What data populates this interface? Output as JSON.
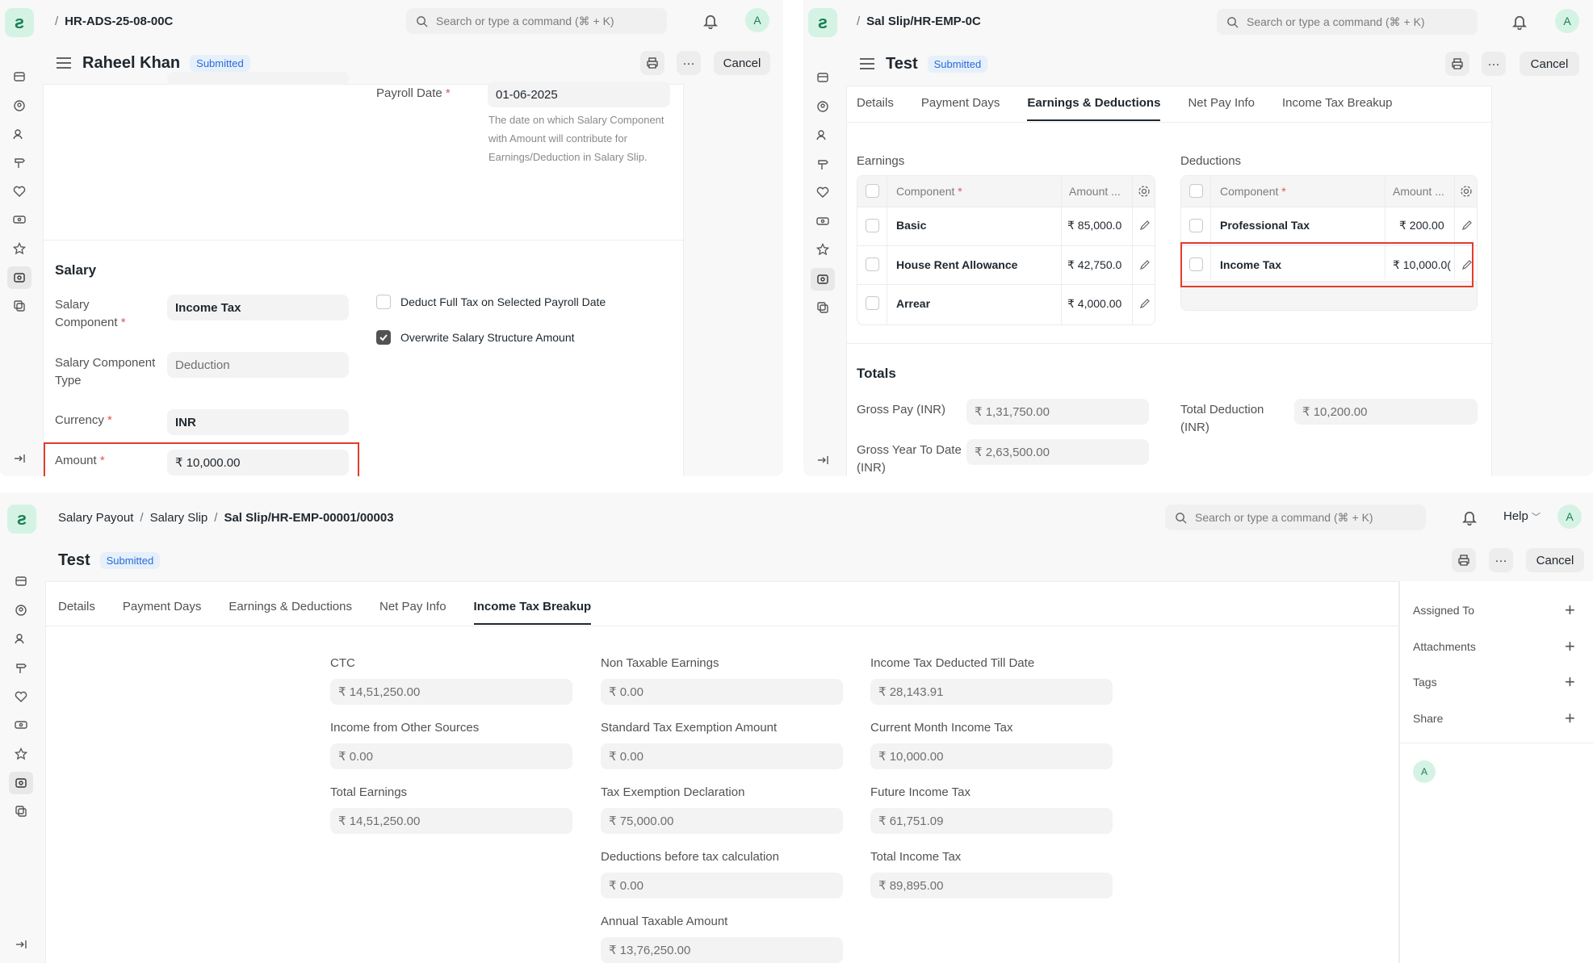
{
  "panel1": {
    "breadcrumb": "HR-ADS-25-08-00C",
    "search_placeholder": "Search or type a command (⌘ + K)",
    "avatar": "A",
    "title": "Raheel Khan",
    "status": "Submitted",
    "more": "···",
    "cancel": "Cancel",
    "payroll_date_label": "Payroll Date",
    "payroll_date": "01-06-2025",
    "payroll_hint": "The date on which Salary Component with Amount will contribute for Earnings/Deduction in Salary Slip.",
    "salary_section": "Salary",
    "salary_component_label": "Salary Component",
    "salary_component": "Income Tax",
    "component_type_label": "Salary Component Type",
    "component_type": "Deduction",
    "currency_label": "Currency",
    "currency": "INR",
    "amount_label": "Amount",
    "amount": "₹ 10,000.00",
    "deduct_full_tax": "Deduct Full Tax on Selected Payroll Date",
    "overwrite_structure": "Overwrite Salary Structure Amount"
  },
  "panel2": {
    "breadcrumb": "Sal Slip/HR-EMP-0C",
    "search_placeholder": "Search or type a command (⌘ + K)",
    "avatar": "A",
    "title": "Test",
    "status": "Submitted",
    "more": "···",
    "cancel": "Cancel",
    "tabs": [
      "Details",
      "Payment Days",
      "Earnings & Deductions",
      "Net Pay Info",
      "Income Tax Breakup"
    ],
    "earnings_title": "Earnings",
    "deductions_title": "Deductions",
    "col_component": "Component",
    "col_amount": "Amount ...",
    "earnings": [
      {
        "component": "Basic",
        "amount": "₹ 85,000.0"
      },
      {
        "component": "House Rent Allowance",
        "amount": "₹ 42,750.0"
      },
      {
        "component": "Arrear",
        "amount": "₹ 4,000.00"
      }
    ],
    "deductions": [
      {
        "component": "Professional Tax",
        "amount": "₹ 200.00"
      },
      {
        "component": "Income Tax",
        "amount": "₹ 10,000.0("
      }
    ],
    "totals_title": "Totals",
    "gross_pay_label": "Gross Pay (INR)",
    "gross_pay": "₹ 1,31,750.00",
    "total_deduction_label": "Total Deduction (INR)",
    "total_deduction": "₹ 10,200.00",
    "gross_ytd_label": "Gross Year To Date (INR)",
    "gross_ytd": "₹ 2,63,500.00"
  },
  "panel3": {
    "breadcrumbs": [
      "Salary Payout",
      "Salary Slip",
      "Sal Slip/HR-EMP-00001/00003"
    ],
    "search_placeholder": "Search or type a command (⌘ + K)",
    "help": "Help",
    "avatar": "A",
    "title": "Test",
    "status": "Submitted",
    "more": "···",
    "cancel": "Cancel",
    "tabs": [
      "Details",
      "Payment Days",
      "Earnings & Deductions",
      "Net Pay Info",
      "Income Tax Breakup"
    ],
    "fields": {
      "ctc_label": "CTC",
      "ctc": "₹ 14,51,250.00",
      "other_sources_label": "Income from Other Sources",
      "other_sources": "₹ 0.00",
      "total_earnings_label": "Total Earnings",
      "total_earnings": "₹ 14,51,250.00",
      "non_taxable_label": "Non Taxable Earnings",
      "non_taxable": "₹ 0.00",
      "std_exemption_label": "Standard Tax Exemption Amount",
      "std_exemption": "₹ 0.00",
      "exemption_decl_label": "Tax Exemption Declaration",
      "exemption_decl": "₹ 75,000.00",
      "deductions_before_label": "Deductions before tax calculation",
      "deductions_before": "₹ 0.00",
      "annual_taxable_label": "Annual Taxable Amount",
      "annual_taxable": "₹ 13,76,250.00",
      "tax_deducted_label": "Income Tax Deducted Till Date",
      "tax_deducted": "₹ 28,143.91",
      "current_month_label": "Current Month Income Tax",
      "current_month": "₹ 10,000.00",
      "future_tax_label": "Future Income Tax",
      "future_tax": "₹ 61,751.09",
      "total_tax_label": "Total Income Tax",
      "total_tax": "₹ 89,895.00"
    },
    "sidebar": [
      "Assigned To",
      "Attachments",
      "Tags",
      "Share"
    ],
    "sidebar_avatar": "A"
  },
  "colors": {
    "highlight": "#e33c2c",
    "badge_text": "#2b6ad8",
    "badge_bg": "#e6f0fb",
    "logo_bg": "#d5f3e4"
  }
}
